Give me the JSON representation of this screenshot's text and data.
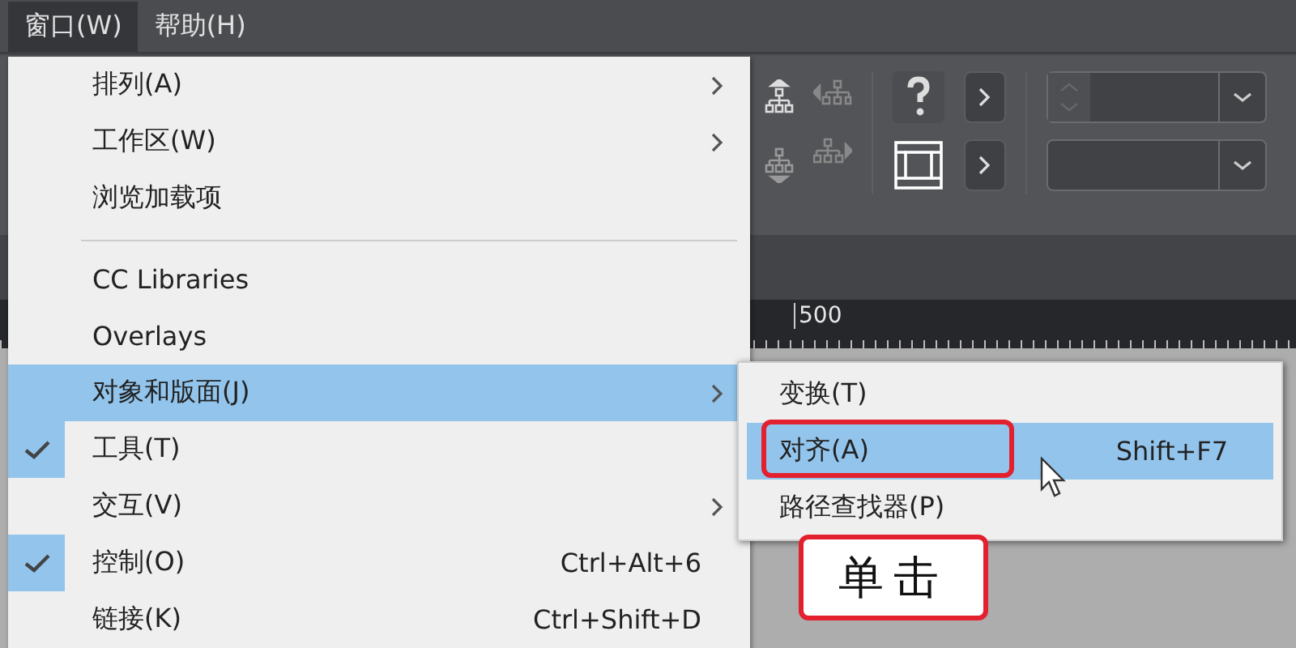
{
  "menubar": [
    {
      "label": "窗口(W)",
      "selected": true
    },
    {
      "label": "帮助(H)",
      "selected": false
    }
  ],
  "menu": [
    {
      "kind": "item",
      "label": "排列(A)",
      "checked": false,
      "submenu": true,
      "selected": false
    },
    {
      "kind": "item",
      "label": "工作区(W)",
      "checked": false,
      "submenu": true,
      "selected": false
    },
    {
      "kind": "item",
      "label": "浏览加载项",
      "checked": false,
      "submenu": false,
      "selected": false
    },
    {
      "kind": "separator"
    },
    {
      "kind": "item",
      "label": "CC Libraries",
      "checked": false,
      "submenu": false,
      "selected": false
    },
    {
      "kind": "item",
      "label": "Overlays",
      "checked": false,
      "submenu": false,
      "selected": false
    },
    {
      "kind": "item",
      "label": "对象和版面(J)",
      "checked": false,
      "submenu": true,
      "selected": true
    },
    {
      "kind": "item",
      "label": "工具(T)",
      "checked": true,
      "submenu": false,
      "selected": false
    },
    {
      "kind": "item",
      "label": "交互(V)",
      "checked": false,
      "submenu": true,
      "selected": false
    },
    {
      "kind": "item",
      "label": "控制(O)",
      "checked": true,
      "submenu": false,
      "selected": false,
      "shortcut": "Ctrl+Alt+6"
    },
    {
      "kind": "item",
      "label": "链接(K)",
      "checked": false,
      "submenu": false,
      "selected": false,
      "shortcut": "Ctrl+Shift+D"
    }
  ],
  "submenu": [
    {
      "label": "变换(T)",
      "selected": false
    },
    {
      "label": "对齐(A)",
      "selected": true,
      "shortcut": "Shift+F7"
    },
    {
      "label": "路径查找器(P)",
      "selected": false
    }
  ],
  "callout": {
    "label": "单击"
  },
  "ruler": {
    "label": "500"
  }
}
